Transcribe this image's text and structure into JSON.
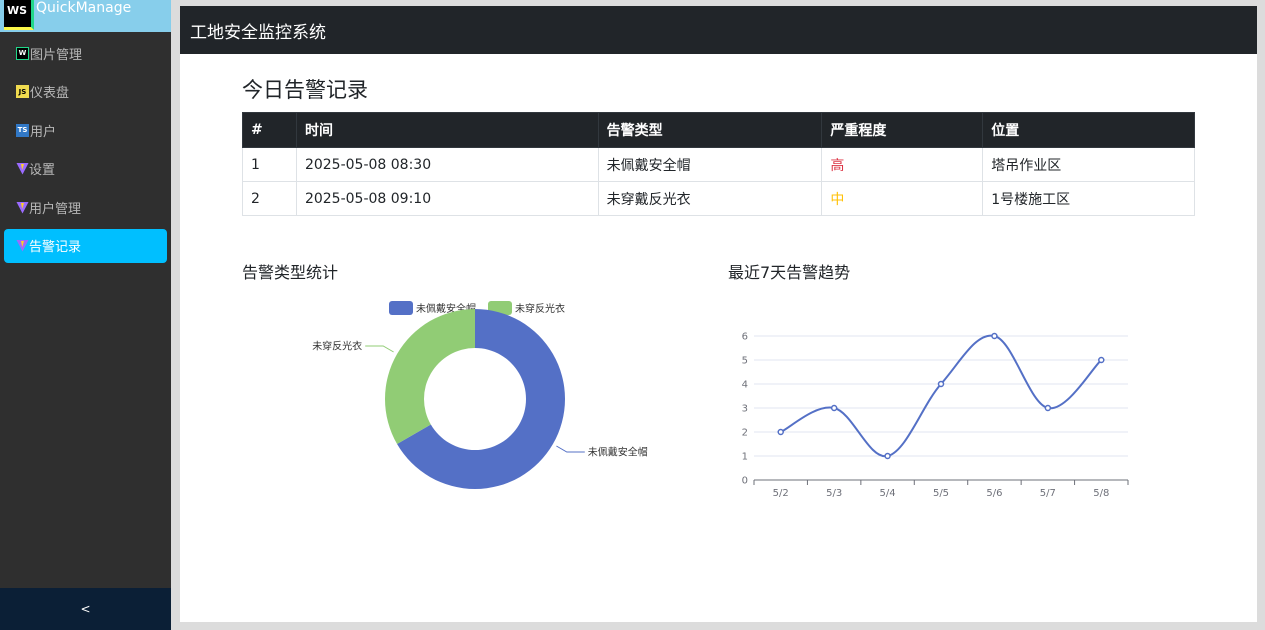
{
  "brand": {
    "logo_text": "WS",
    "name": "QuickManage"
  },
  "sidebar": {
    "items": [
      {
        "label": "图片管理",
        "icon": "webstorm-icon",
        "active": false
      },
      {
        "label": "仪表盘",
        "icon": "javascript-icon",
        "active": false
      },
      {
        "label": "用户",
        "icon": "typescript-icon",
        "active": false
      },
      {
        "label": "设置",
        "icon": "vite-icon",
        "active": false
      },
      {
        "label": "用户管理",
        "icon": "vite-icon",
        "active": false
      },
      {
        "label": "告警记录",
        "icon": "vite-icon",
        "active": true
      }
    ],
    "collapse_label": "<"
  },
  "header": {
    "title": "工地安全监控系统"
  },
  "alerts": {
    "title": "今日告警记录",
    "columns": [
      "#",
      "时间",
      "告警类型",
      "严重程度",
      "位置"
    ],
    "rows": [
      {
        "no": "1",
        "time": "2025-05-08 08:30",
        "type": "未佩戴安全帽",
        "severity": "高",
        "severity_color": "#dc3545",
        "location": "塔吊作业区"
      },
      {
        "no": "2",
        "time": "2025-05-08 09:10",
        "type": "未穿戴反光衣",
        "severity": "中",
        "severity_color": "#ffc107",
        "location": "1号楼施工区"
      }
    ]
  },
  "colors": {
    "sidebar_bg": "#2f2f2f",
    "active": "#00bfff",
    "header_bg": "#212529",
    "series_blue": "#5470c6",
    "series_green": "#91cc75"
  },
  "chart_data": [
    {
      "type": "pie",
      "title": "告警类型统计",
      "legend_position": "top",
      "labels": [
        "未佩戴安全帽",
        "未穿反光衣"
      ],
      "values": [
        2,
        1
      ],
      "colors": [
        "#5470c6",
        "#91cc75"
      ]
    },
    {
      "type": "line",
      "title": "最近7天告警趋势",
      "categories": [
        "5/2",
        "5/3",
        "5/4",
        "5/5",
        "5/6",
        "5/7",
        "5/8"
      ],
      "values": [
        2,
        3,
        1,
        4,
        6,
        3,
        5
      ],
      "ylim": [
        0,
        6
      ],
      "yticks": [
        "0",
        "1",
        "2",
        "3",
        "4",
        "5",
        "6"
      ],
      "smooth": true,
      "grid": true,
      "color": "#5470c6"
    }
  ]
}
